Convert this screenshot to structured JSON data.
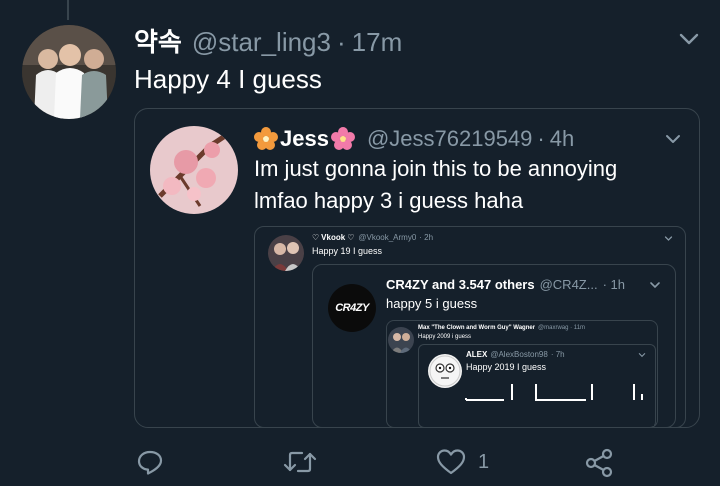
{
  "main_tweet": {
    "display_name": "약속",
    "handle": "@star_ling3",
    "separator": "·",
    "time": "17m",
    "text": "Happy 4 I guess"
  },
  "quote1": {
    "display_name": "Jess",
    "handle": "@Jess76219549",
    "separator": "·",
    "time": "4h",
    "text_line1": "Im just gonna join this to be annoying",
    "text_line2": "lmfao happy 3 i guess haha"
  },
  "quote2": {
    "heart_left": "♡",
    "display_name": "Vkook",
    "heart_right": "♡",
    "handle": "@Vkook_Army0",
    "time": "· 2h",
    "text": "Happy 19 I guess"
  },
  "quote3": {
    "avatar_text": "CR4ZY",
    "display_name": "CR4ZY and 3.547 others",
    "handle": "@CR4Z...",
    "time": "· 1h",
    "text": "happy 5 i guess"
  },
  "quote4": {
    "display_name": "Max \"The Clown and Worm Guy\" Wagner",
    "handle": "@maxrwag · 11m",
    "text": "Happy 2009 i guess"
  },
  "quote5": {
    "display_name": "ALEX",
    "handle": "@AlexBoston98",
    "time": "· 7h",
    "text": "Happy 2019 I guess"
  },
  "actions": {
    "like_count": "1"
  },
  "colors": {
    "background": "#15202b",
    "border": "#38444d",
    "muted": "#8899a6",
    "text": "#e1e8ed"
  },
  "icons": [
    "chevron-down-icon",
    "reply-icon",
    "retweet-icon",
    "heart-icon",
    "share-icon",
    "flower-icon"
  ]
}
